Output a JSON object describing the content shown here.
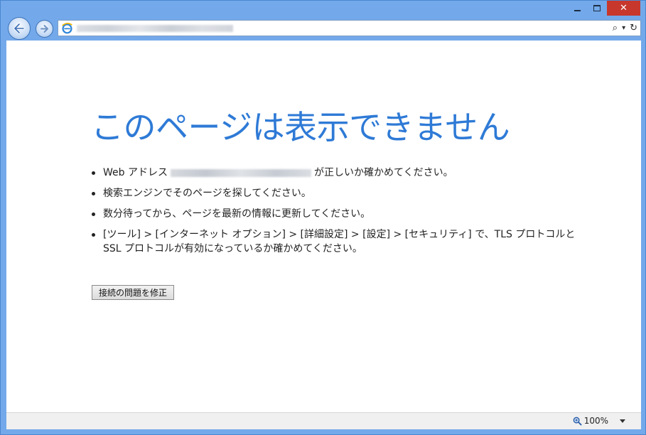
{
  "window": {
    "close_glyph": "✕"
  },
  "toolbar": {
    "search_glyph": "⌕",
    "dropdown_glyph": "▾",
    "refresh_glyph": "↻"
  },
  "page": {
    "title": "このページは表示できません",
    "tips": {
      "web_address_prefix": "Web アドレス",
      "web_address_suffix": "が正しいか確かめてください。",
      "search_tip": "検索エンジンでそのページを探してください。",
      "refresh_tip": "数分待ってから、ページを最新の情報に更新してください。",
      "tls_tip": "[ツール] > [インターネット オプション] > [詳細設定] > [設定] > [セキュリティ] で、TLS プロトコルと SSL プロトコルが有効になっているか確かめてください。"
    },
    "fix_button_label": "接続の問題を修正"
  },
  "status": {
    "zoom_level": "100%"
  },
  "colors": {
    "frame": "#73a9ea",
    "title": "#2e7ad6",
    "close_button": "#c7372c"
  },
  "icons": [
    "back-arrow-icon",
    "forward-arrow-icon",
    "ie-logo-icon",
    "search-icon",
    "refresh-icon",
    "zoom-icon"
  ]
}
